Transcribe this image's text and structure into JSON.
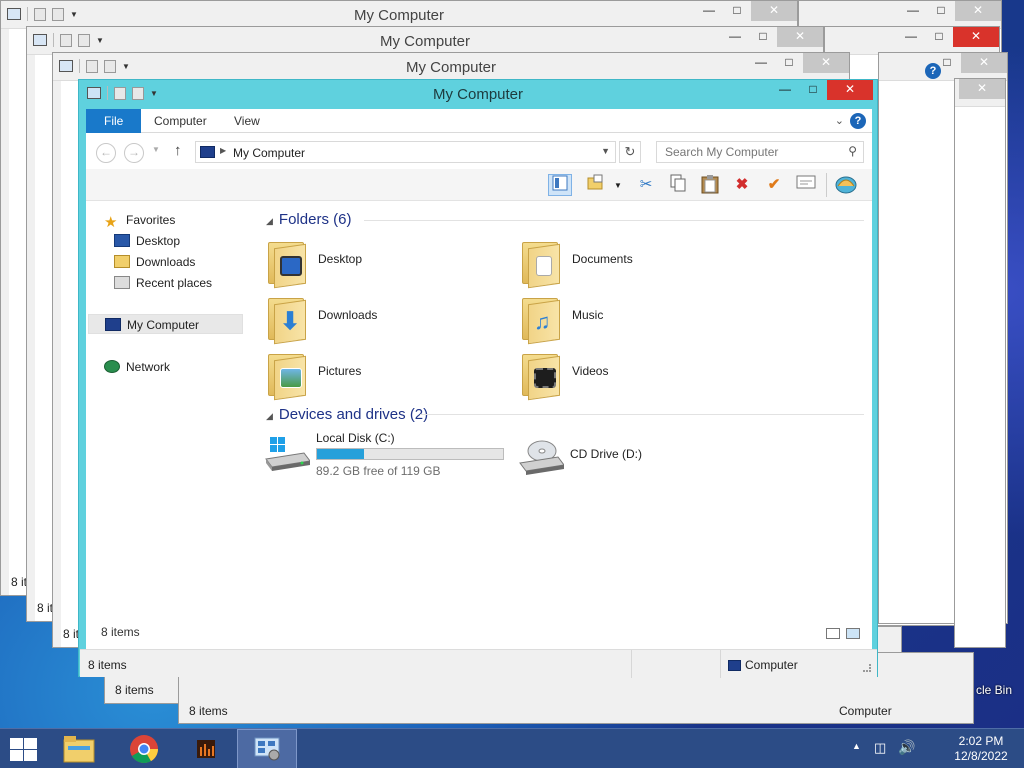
{
  "window": {
    "title": "My Computer",
    "tabs": [
      "File",
      "Computer",
      "View"
    ],
    "help": "?"
  },
  "background_windows": {
    "title": "My Computer",
    "status_text": "8 items",
    "status_computer": "Computer",
    "side_text": "8 it"
  },
  "address": {
    "path": "My Computer",
    "search_placeholder": "Search My Computer"
  },
  "nav": {
    "favorites": "Favorites",
    "desktop": "Desktop",
    "downloads": "Downloads",
    "recent": "Recent places",
    "computer": "My Computer",
    "network": "Network"
  },
  "folders_header": "Folders (6)",
  "folders": [
    {
      "name": "Desktop",
      "icon": "desktop-folder-icon"
    },
    {
      "name": "Documents",
      "icon": "documents-folder-icon"
    },
    {
      "name": "Downloads",
      "icon": "downloads-folder-icon"
    },
    {
      "name": "Music",
      "icon": "music-folder-icon"
    },
    {
      "name": "Pictures",
      "icon": "pictures-folder-icon"
    },
    {
      "name": "Videos",
      "icon": "videos-folder-icon"
    }
  ],
  "drives_header": "Devices and drives (2)",
  "drives": [
    {
      "name": "Local Disk (C:)",
      "free": "89.2 GB free of 119 GB",
      "used_fraction": 0.25
    },
    {
      "name": "CD Drive (D:)"
    }
  ],
  "inner_status": "8 items",
  "status": {
    "items": "8 items",
    "computer": "Computer"
  },
  "desktop_label": "cle Bin",
  "clock": {
    "time": "2:02 PM",
    "date": "12/8/2022"
  },
  "colors": {
    "accent": "#5fd1de",
    "file_tab": "#1979ca",
    "close": "#d9332b",
    "disk_bar": "#26a0da"
  }
}
